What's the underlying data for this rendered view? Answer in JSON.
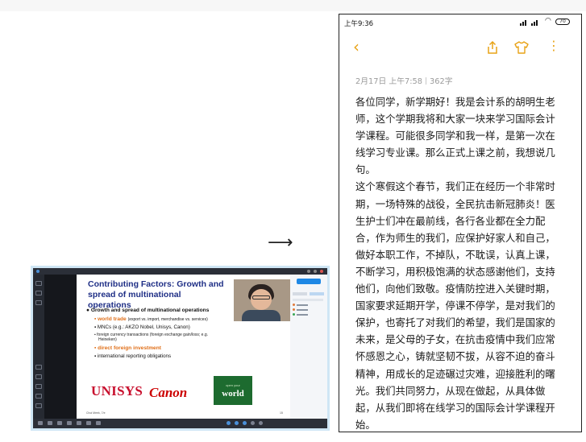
{
  "arrow": "⟶",
  "slide": {
    "title": "Contributing Factors: Growth and spread of multinational operations",
    "bullets": [
      {
        "text": "Growth and spread of multinational operations",
        "style": "main"
      },
      {
        "text": "world trade",
        "suffix": "(export vs. import, merchandise vs. services)",
        "style": "red"
      },
      {
        "text": "MNCs (e.g.: AKZO Nobel, Unisys, Canon)",
        "style": "normal"
      },
      {
        "text": "foreign currency transactions (foreign exchange gain/loss; e.g.",
        "style": "small"
      },
      {
        "text": "Heineken)",
        "style": "small"
      },
      {
        "text": "direct foreign investment",
        "style": "red"
      },
      {
        "text": "international reporting obligations",
        "style": "normal"
      }
    ],
    "logos": {
      "unisys": "UNISYS",
      "canon": "Canon",
      "world_small": "open your",
      "world_big": "world"
    },
    "footer": "Choi Meek, 7/e",
    "page": "15"
  },
  "phone": {
    "status_time": "上午9:36",
    "battery": "70",
    "icons": {
      "back": "chevron-left-icon",
      "share": "share-icon",
      "theme": "shirt-icon",
      "more": "more-vertical-icon"
    },
    "accent_color": "#e8a317",
    "meta_date": "2月17日  上午7:58",
    "meta_count": "362字",
    "paragraphs": [
      "各位同学，新学期好！我是会计系的胡明生老师，这个学期我将和大家一块来学习国际会计学课程。可能很多同学和我一样，是第一次在线学习专业课。那么正式上课之前，我想说几句。",
      "这个寒假这个春节，我们正在经历一个非常时期，一场特殊的战役，全民抗击新冠肺炎！医生护士们冲在最前线，各行各业都在全力配合，作为师生的我们，应保护好家人和自己，做好本职工作，不掉队，不耽误，认真上课，不断学习，用积极饱满的状态感谢他们，支持他们，向他们致敬。疫情防控进入关键时期，国家要求延期开学，停课不停学，是对我们的保护，也寄托了对我们的希望，我们是国家的未来，是父母的子女，在抗击疫情中我们应常怀感恩之心，铸就坚韧不拔，从容不迫的奋斗精神，用成长的足迹碾过灾难，迎接胜利的曙光。我们共同努力，从现在做起，从具体做起，从我们即将在线学习的国际会计学课程开始。"
    ]
  }
}
